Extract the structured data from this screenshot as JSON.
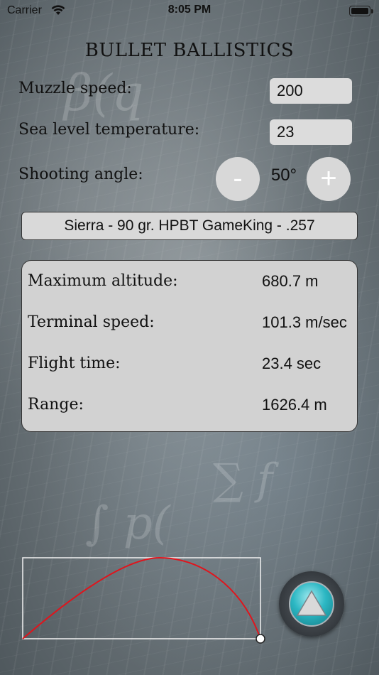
{
  "status_bar": {
    "carrier": "Carrier",
    "time": "8:05 PM"
  },
  "app": {
    "title": "BULLET BALLISTICS"
  },
  "inputs": {
    "muzzle_speed": {
      "label": "Muzzle speed:",
      "value": "200"
    },
    "sea_level_temperature": {
      "label": "Sea level temperature:",
      "value": "23"
    },
    "shooting_angle": {
      "label": "Shooting angle:",
      "value": "50°",
      "minus_label": "-",
      "plus_label": "+"
    }
  },
  "bullet": {
    "selected": "Sierra - 90 gr. HPBT GameKing - .257"
  },
  "results": [
    {
      "label": "Maximum altitude:",
      "value": "680.7 m"
    },
    {
      "label": "Terminal speed:",
      "value": "101.3 m/sec"
    },
    {
      "label": "Flight time:",
      "value": "23.4 sec"
    },
    {
      "label": "Range:",
      "value": "1626.4 m"
    }
  ],
  "trajectory": {
    "line_color": "#e0141c",
    "frame_color": "#f2f2f2"
  },
  "fire_button": {
    "icon": "triangle-up-icon",
    "accent": "#2cb7c3"
  }
}
